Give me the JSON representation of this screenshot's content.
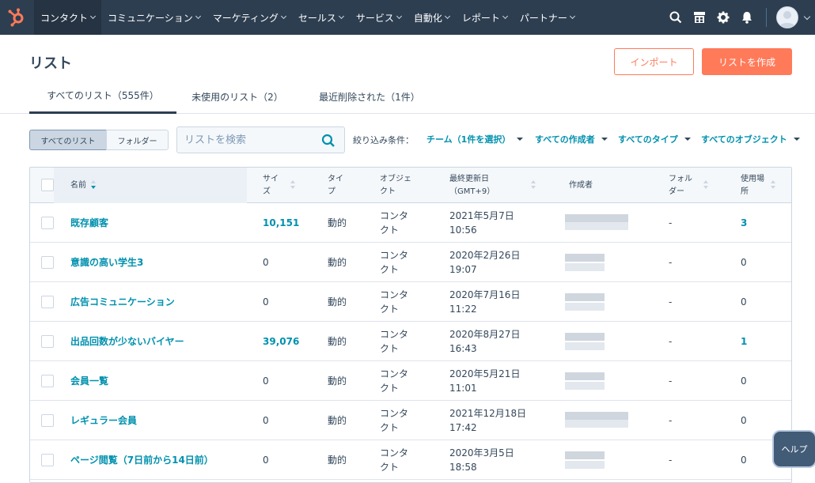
{
  "nav": {
    "items": [
      {
        "label": "コンタクト",
        "active": true
      },
      {
        "label": "コミュニケーション",
        "active": false
      },
      {
        "label": "マーケティング",
        "active": false
      },
      {
        "label": "セールス",
        "active": false
      },
      {
        "label": "サービス",
        "active": false
      },
      {
        "label": "自動化",
        "active": false
      },
      {
        "label": "レポート",
        "active": false
      },
      {
        "label": "パートナー",
        "active": false
      }
    ],
    "icons": [
      "search-icon",
      "marketplace-icon",
      "settings-gear-icon",
      "notifications-bell-icon"
    ]
  },
  "page": {
    "title": "リスト",
    "import_label": "インポート",
    "create_label": "リストを作成"
  },
  "tabs": [
    {
      "label": "すべてのリスト（555件）",
      "active": true
    },
    {
      "label": "未使用のリスト（2）",
      "active": false
    },
    {
      "label": "最近削除された（1件）",
      "active": false
    }
  ],
  "view_toggle": {
    "all": "すべてのリスト",
    "folders": "フォルダー"
  },
  "search": {
    "placeholder": "リストを検索",
    "value": ""
  },
  "filters": {
    "label": "絞り込み条件：",
    "items": [
      "チーム（1件を選択）",
      "すべての作成者",
      "すべてのタイプ",
      "すべてのオブジェクト"
    ]
  },
  "table": {
    "columns": {
      "name": "名前",
      "size_1": "サイ",
      "size_2": "ズ",
      "type_1": "タイ",
      "type_2": "プ",
      "object_1": "オブジェ",
      "object_2": "クト",
      "updated_1": "最終更新日",
      "updated_2": "（GMT+9）",
      "creator": "作成者",
      "folder_1": "フォル",
      "folder_2": "ダー",
      "usage_1": "使用場",
      "usage_2": "所"
    },
    "rows": [
      {
        "name": "既存顧客",
        "size": "10,151",
        "size_link": true,
        "type": "動的",
        "object_1": "コンタ",
        "object_2": "クト",
        "date": "2021年5月7日",
        "time": "10:56",
        "folder": "-",
        "usage": "3",
        "usage_link": true
      },
      {
        "name": "意識の高い学生3",
        "size": "0",
        "size_link": false,
        "type": "動的",
        "object_1": "コンタ",
        "object_2": "クト",
        "date": "2020年2月26日",
        "time": "19:07",
        "folder": "-",
        "usage": "0",
        "usage_link": false
      },
      {
        "name": "広告コミュニケーション",
        "size": "0",
        "size_link": false,
        "type": "動的",
        "object_1": "コンタ",
        "object_2": "クト",
        "date": "2020年7月16日",
        "time": "11:22",
        "folder": "-",
        "usage": "0",
        "usage_link": false
      },
      {
        "name": "出品回数が少ないバイヤー",
        "size": "39,076",
        "size_link": true,
        "type": "動的",
        "object_1": "コンタ",
        "object_2": "クト",
        "date": "2020年8月27日",
        "time": "16:43",
        "folder": "-",
        "usage": "1",
        "usage_link": true
      },
      {
        "name": "会員一覧",
        "size": "0",
        "size_link": false,
        "type": "動的",
        "object_1": "コンタ",
        "object_2": "クト",
        "date": "2020年5月21日",
        "time": "11:01",
        "folder": "-",
        "usage": "0",
        "usage_link": false
      },
      {
        "name": "レギュラー会員",
        "size": "0",
        "size_link": false,
        "type": "動的",
        "object_1": "コンタ",
        "object_2": "クト",
        "date": "2021年12月18日",
        "time": "17:42",
        "folder": "-",
        "usage": "0",
        "usage_link": false
      },
      {
        "name": "ページ閲覧（7日前から14日前）",
        "size": "0",
        "size_link": false,
        "type": "動的",
        "object_1": "コンタ",
        "object_2": "クト",
        "date": "2020年3月5日",
        "time": "18:58",
        "folder": "-",
        "usage": "0",
        "usage_link": false
      }
    ]
  },
  "help_label": "ヘルプ",
  "colors": {
    "nav_bg": "#2d3e50",
    "accent": "#ff7a59",
    "link": "#0091ae",
    "text": "#33475b"
  }
}
